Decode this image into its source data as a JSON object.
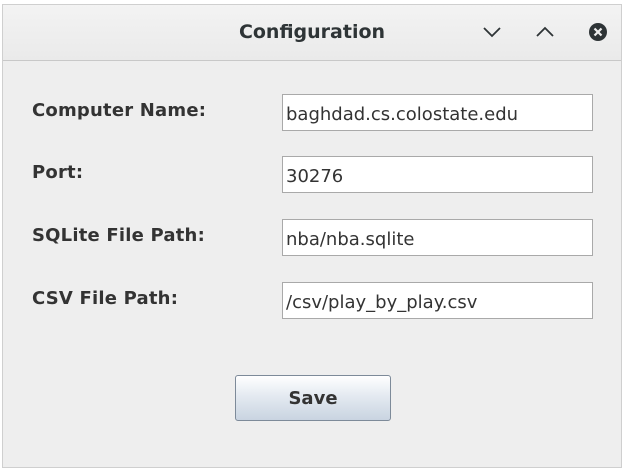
{
  "window": {
    "title": "Configuration"
  },
  "titlebar_buttons": {
    "minimize_icon": "chevron-down-icon",
    "maximize_icon": "chevron-up-icon",
    "close_icon": "close-circle-icon"
  },
  "form": {
    "computer_name": {
      "label": "Computer Name:",
      "value": "baghdad.cs.colostate.edu"
    },
    "port": {
      "label": "Port:",
      "value": "30276"
    },
    "sqlite_path": {
      "label": "SQLite File Path:",
      "value": "nba/nba.sqlite"
    },
    "csv_path": {
      "label": "CSV File Path:",
      "value": "/csv/play_by_play.csv"
    },
    "save_label": "Save"
  },
  "colors": {
    "window_bg": "#eeeeee",
    "text": "#333333",
    "field_border": "#a9a9a9",
    "button_border": "#7d8a99"
  }
}
